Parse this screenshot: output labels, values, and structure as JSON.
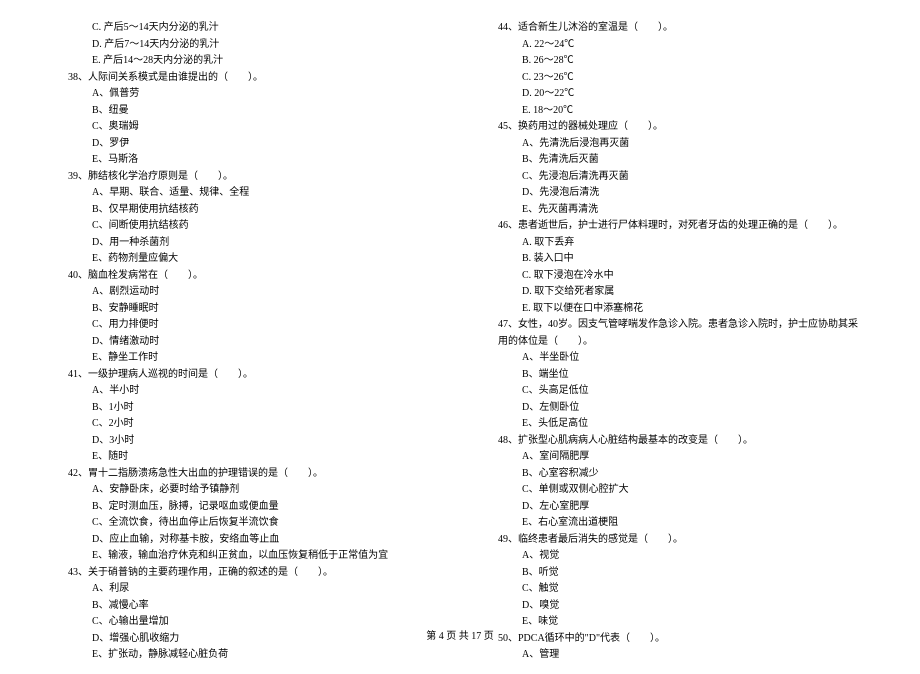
{
  "left": {
    "pre_opts": [
      "C. 产后5～14天内分泌的乳汁",
      "D. 产后7～14天内分泌的乳汁",
      "E. 产后14～28天内分泌的乳汁"
    ],
    "q38": "38、人际间关系模式是由谁提出的（　　）。",
    "q38_opts": [
      "A、佩普劳",
      "B、纽曼",
      "C、奥瑞姆",
      "D、罗伊",
      "E、马斯洛"
    ],
    "q39": "39、肺结核化学治疗原则是（　　）。",
    "q39_opts": [
      "A、早期、联合、适量、规律、全程",
      "B、仅早期使用抗结核药",
      "C、间断使用抗结核药",
      "D、用一种杀菌剂",
      "E、药物剂量应偏大"
    ],
    "q40": "40、脑血栓发病常在（　　）。",
    "q40_opts": [
      "A、剧烈运动时",
      "B、安静睡眠时",
      "C、用力排便时",
      "D、情绪激动时",
      "E、静坐工作时"
    ],
    "q41": "41、一级护理病人巡视的时间是（　　）。",
    "q41_opts": [
      "A、半小时",
      "B、1小时",
      "C、2小时",
      "D、3小时",
      "E、随时"
    ],
    "q42": "42、胃十二指肠溃疡急性大出血的护理错误的是（　　）。",
    "q42_opts": [
      "A、安静卧床，必要时给予镇静剂",
      "B、定时测血压，脉搏，记录呕血或便血量",
      "C、全流饮食，待出血停止后恢复半流饮食",
      "D、应止血输，对称基卡胺，安络血等止血",
      "E、输液，输血治疗休克和纠正贫血，以血压恢复稍低于正常值为宜"
    ],
    "q43": "43、关于硝普钠的主要药理作用，正确的叙述的是（　　）。",
    "q43_opts": [
      "A、利尿",
      "B、减慢心率",
      "C、心输出量增加",
      "D、增强心肌收缩力",
      "E、扩张动，静脉减轻心脏负荷"
    ]
  },
  "right": {
    "q44": "44、适合新生儿沐浴的室温是（　　）。",
    "q44_opts": [
      "A. 22～24℃",
      "B. 26～28℃",
      "C. 23～26℃",
      "D. 20～22℃",
      "E. 18～20℃"
    ],
    "q45": "45、换药用过的器械处理应（　　）。",
    "q45_opts": [
      "A、先清洗后浸泡再灭菌",
      "B、先清洗后灭菌",
      "C、先浸泡后清洗再灭菌",
      "D、先浸泡后清洗",
      "E、先灭菌再清洗"
    ],
    "q46": "46、患者逝世后，护士进行尸体料理时，对死者牙齿的处理正确的是（　　）。",
    "q46_opts": [
      "A. 取下丢弃",
      "B. 装入口中",
      "C. 取下浸泡在冷水中",
      "D. 取下交给死者家属",
      "E. 取下以便在口中添塞棉花"
    ],
    "q47": "47、女性，40岁。因支气管哮喘发作急诊入院。患者急诊入院时，护士应协助其采用的体位是（　　）。",
    "q47_opts": [
      "A、半坐卧位",
      "B、端坐位",
      "C、头高足低位",
      "D、左侧卧位",
      "E、头低足高位"
    ],
    "q48": "48、扩张型心肌病病人心脏结构最基本的改变是（　　）。",
    "q48_opts": [
      "A、室间隔肥厚",
      "B、心室容积减少",
      "C、单侧或双侧心腔扩大",
      "D、左心室肥厚",
      "E、右心室流出道梗阻"
    ],
    "q49": "49、临终患者最后消失的感觉是（　　）。",
    "q49_opts": [
      "A、视觉",
      "B、听觉",
      "C、触觉",
      "D、嗅觉",
      "E、味觉"
    ],
    "q50": "50、PDCA循环中的\"D\"代表（　　）。",
    "q50_opts": [
      "A、管理"
    ]
  },
  "footer": "第 4 页 共 17 页"
}
